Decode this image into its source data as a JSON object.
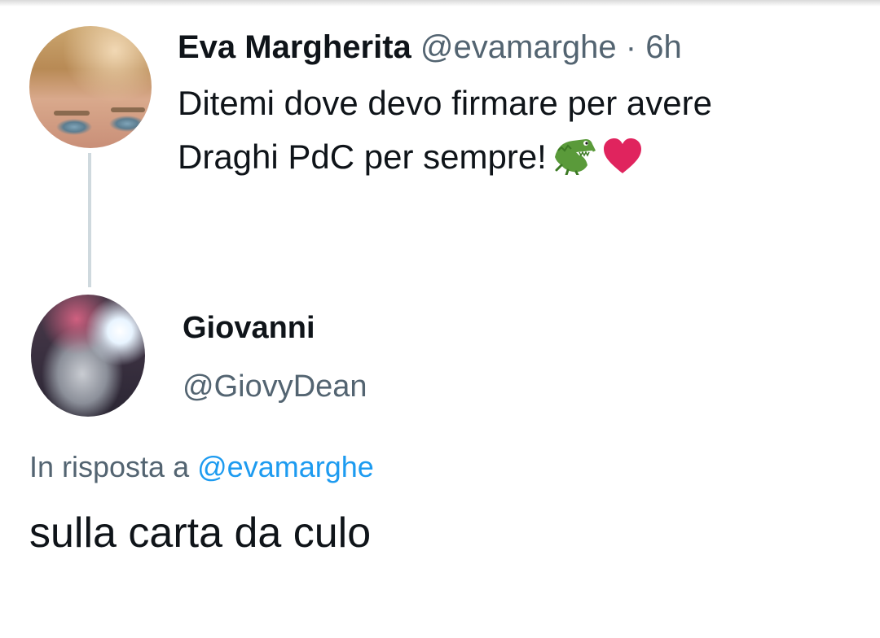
{
  "tweet": {
    "author_name": "Eva Margherita",
    "author_handle": "@evamarghe",
    "separator": "·",
    "time": "6h",
    "text_line1": "Ditemi dove devo firmare per avere",
    "text_line2": "Draghi PdC per sempre!",
    "emojis": [
      "crocodile-emoji",
      "red-heart-emoji"
    ]
  },
  "reply": {
    "author_name": "Giovanni",
    "author_handle": "@GiovyDean",
    "in_reply_prefix": "In risposta a",
    "in_reply_handle": "@evamarghe",
    "text": "sulla carta da culo"
  },
  "colors": {
    "text": "#0f1419",
    "secondary": "#536471",
    "link": "#1d9bf0",
    "thread_line": "#cfd9de",
    "heart": "#e0245e"
  }
}
